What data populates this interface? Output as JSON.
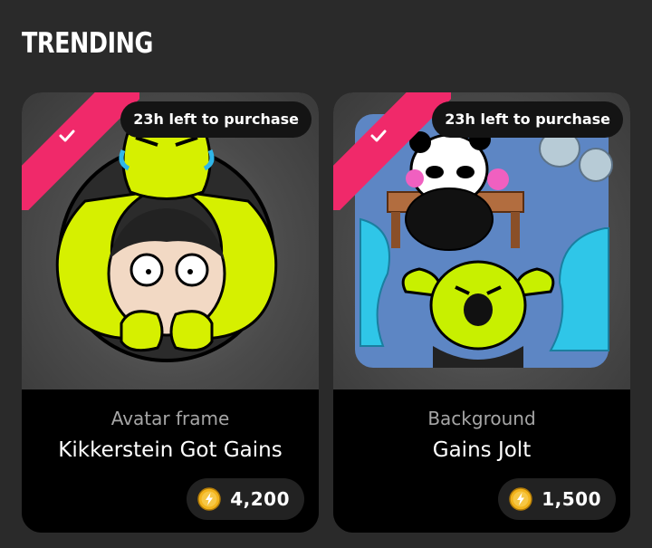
{
  "section": {
    "title": "TRENDING"
  },
  "items": [
    {
      "timer": "23h left to purchase",
      "category": "Avatar frame",
      "name": "Kikkerstein Got Gains",
      "price": "4,200",
      "owned_icon": "check-icon",
      "currency_icon": "lightning-coin-icon"
    },
    {
      "timer": "23h left to purchase",
      "category": "Background",
      "name": "Gains Jolt",
      "price": "1,500",
      "owned_icon": "check-icon",
      "currency_icon": "lightning-coin-icon"
    }
  ],
  "colors": {
    "ribbon": "#f0296a",
    "lime": "#c8f000",
    "background": "#2a2a2a"
  }
}
